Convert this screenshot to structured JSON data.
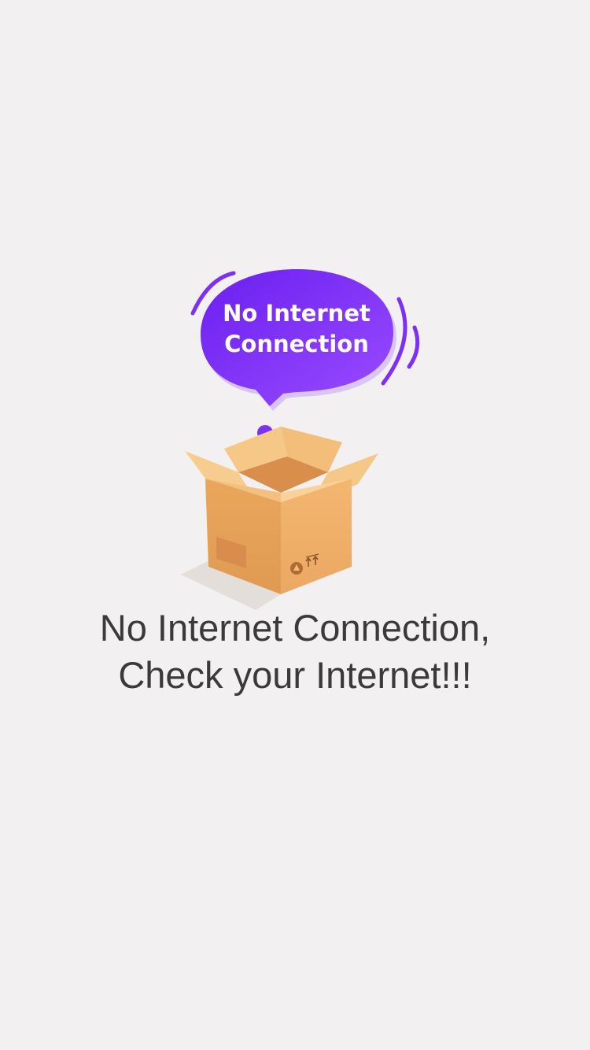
{
  "illustration": {
    "bubble_line1": "No Internet",
    "bubble_line2": "Connection",
    "bubble_color": "#7b2ff7",
    "box_color": "#f0b56e",
    "icon": "open-cardboard-box-icon"
  },
  "message": {
    "line1": "No Internet Connection,",
    "line2": "Check your Internet!!!"
  }
}
